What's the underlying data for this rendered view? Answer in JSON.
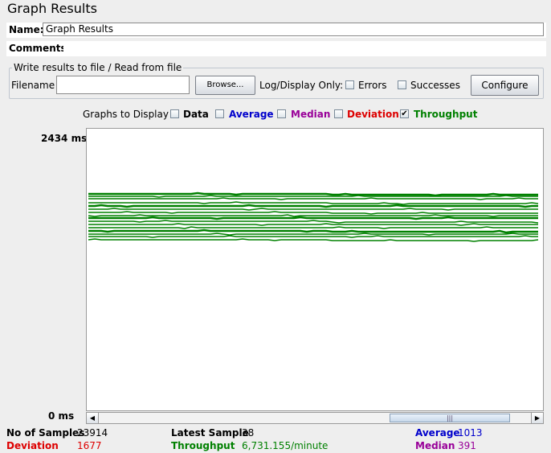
{
  "window": {
    "title": "Graph Results"
  },
  "name_field": {
    "label": "Name:",
    "value": "Graph Results"
  },
  "comments_field": {
    "label": "Comments:"
  },
  "file_group": {
    "legend": "Write results to file / Read from file",
    "filename_label": "Filename",
    "browse_label": "Browse...",
    "log_display_label": "Log/Display Only:",
    "errors_label": "Errors",
    "successes_label": "Successes",
    "configure_label": "Configure"
  },
  "graphs_to_display": {
    "label": "Graphs to Display",
    "options": [
      {
        "label": "Data",
        "checked": false,
        "color": "#000000"
      },
      {
        "label": "Average",
        "checked": false,
        "color": "#0000cc"
      },
      {
        "label": "Median",
        "checked": false,
        "color": "#990099"
      },
      {
        "label": "Deviation",
        "checked": false,
        "color": "#dd0000"
      },
      {
        "label": "Throughput",
        "checked": true,
        "color": "#008000"
      }
    ]
  },
  "graph": {
    "y_max_label": "2434  ms",
    "y_min_label": "0  ms",
    "throughput_color": "#008000"
  },
  "stats": {
    "no_of_samples_label": "No of Samples",
    "no_of_samples": "23914",
    "latest_sample_label": "Latest Sample",
    "latest_sample": "38",
    "average_label": "Average",
    "average": "1013",
    "deviation_label": "Deviation",
    "deviation": "1677",
    "throughput_label": "Throughput",
    "throughput": "6,731.155/minute",
    "median_label": "Median",
    "median": "391"
  }
}
